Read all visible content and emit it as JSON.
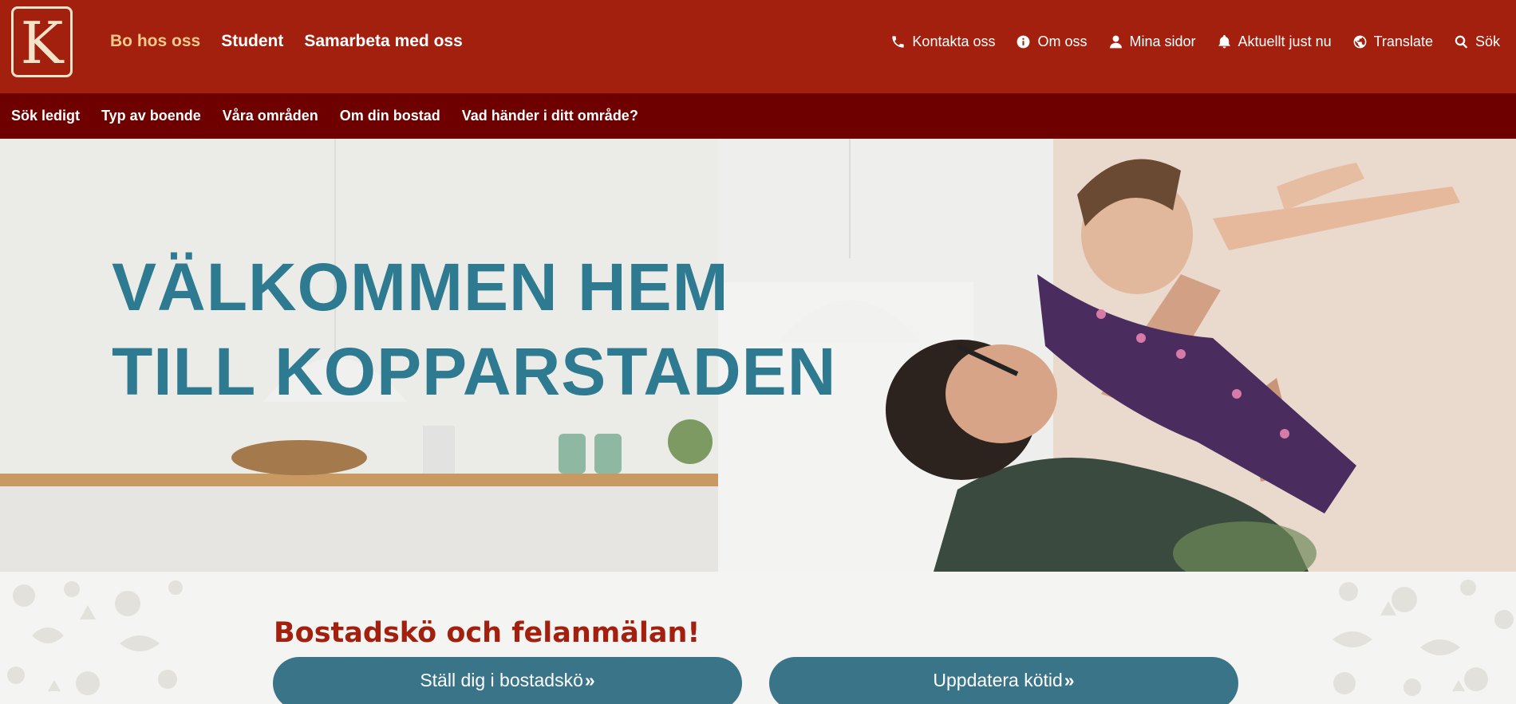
{
  "header": {
    "logo_letter": "K",
    "main_nav": [
      {
        "label": "Bo hos oss",
        "active": true
      },
      {
        "label": "Student",
        "active": false
      },
      {
        "label": "Samarbeta med oss",
        "active": false
      }
    ],
    "util_nav": [
      {
        "label": "Kontakta oss",
        "icon": "phone-icon"
      },
      {
        "label": "Om oss",
        "icon": "info-icon"
      },
      {
        "label": "Mina sidor",
        "icon": "user-icon"
      },
      {
        "label": "Aktuellt just nu",
        "icon": "bell-icon"
      },
      {
        "label": "Translate",
        "icon": "globe-icon"
      },
      {
        "label": "Sök",
        "icon": "search-icon"
      }
    ]
  },
  "subnav": {
    "items": [
      "Sök ledigt",
      "Typ av boende",
      "Våra områden",
      "Om din bostad",
      "Vad händer i ditt område?"
    ]
  },
  "hero": {
    "title_line1": "VÄLKOMMEN HEM",
    "title_line2": "TILL KOPPARSTADEN"
  },
  "section": {
    "title": "Bostadskö och felanmälan!",
    "buttons": [
      {
        "label": "Ställ dig i bostadskö",
        "chevron": "»"
      },
      {
        "label": "Uppdatera kötid",
        "chevron": "»"
      }
    ]
  },
  "colors": {
    "brand_red": "#a3200e",
    "dark_red": "#6f0000",
    "accent_gold": "#f5c88d",
    "hero_teal": "#2d7a91",
    "button_teal": "#3a7489"
  }
}
